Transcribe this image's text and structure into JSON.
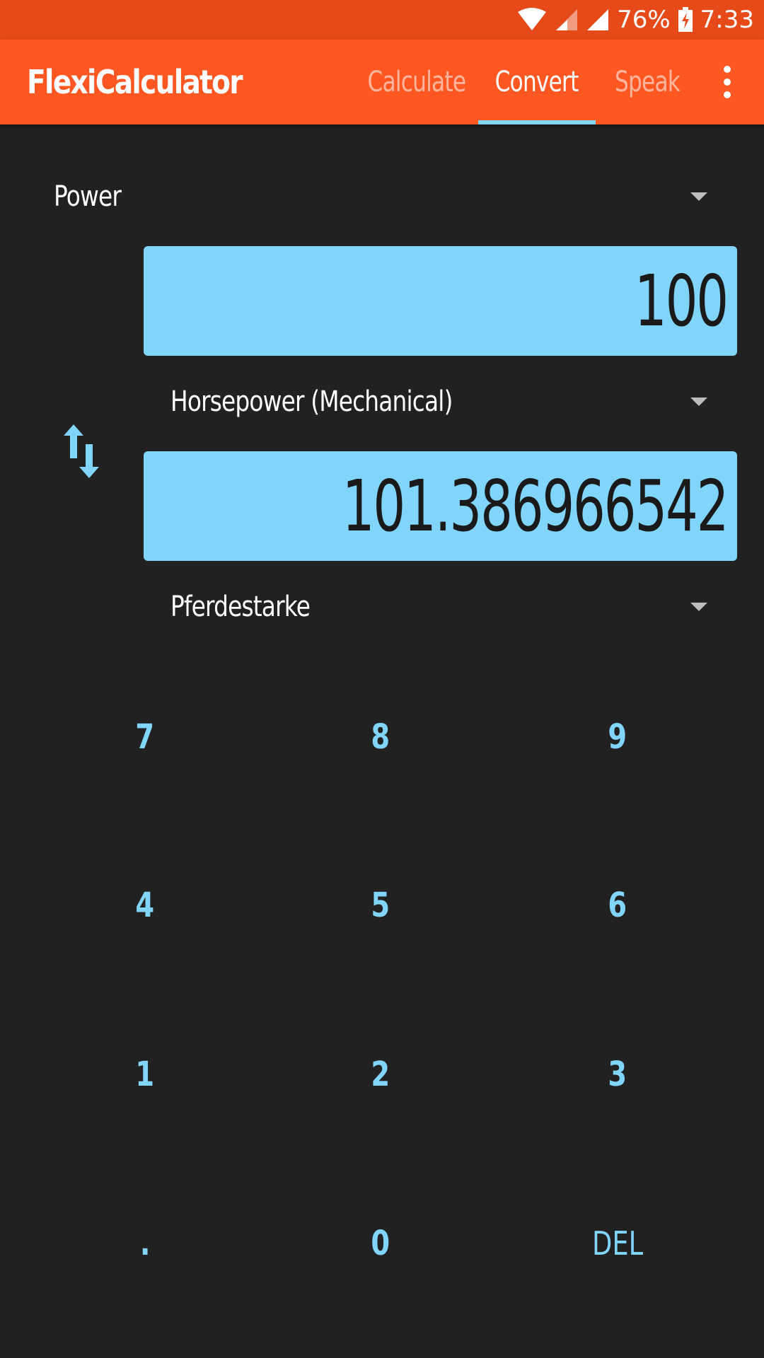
{
  "status_bar": {
    "battery": "76%",
    "time": "7:33",
    "icons": [
      "wifi-icon",
      "signal-weak-icon",
      "signal-icon",
      "battery-charging-icon"
    ]
  },
  "app_bar": {
    "title": "FlexiCalculator",
    "tabs": [
      {
        "label": "Calculate",
        "active": false
      },
      {
        "label": "Convert",
        "active": true
      },
      {
        "label": "Speak",
        "active": false
      }
    ],
    "menu_icon": "more-vert-icon"
  },
  "converter": {
    "category": "Power",
    "input_value": "100",
    "input_unit": "Horsepower (Mechanical)",
    "output_value": "101.386966542",
    "output_unit": "Pferdestarke",
    "swap_icon": "swap-vertical-icon"
  },
  "keypad": {
    "rows": [
      [
        "7",
        "8",
        "9"
      ],
      [
        "4",
        "5",
        "6"
      ],
      [
        "1",
        "2",
        "3"
      ],
      [
        ".",
        "0",
        "DEL"
      ]
    ]
  },
  "colors": {
    "status_bar": "#E64A19",
    "app_bar": "#FF5722",
    "background": "#212121",
    "accent": "#81D4FA",
    "inactive_tab": "#FFB59D"
  }
}
